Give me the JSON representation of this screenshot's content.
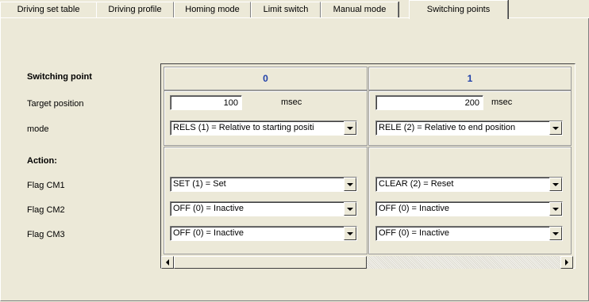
{
  "tabs": [
    {
      "label": "Driving set table",
      "active": false
    },
    {
      "label": "Driving profile",
      "active": false
    },
    {
      "label": "Homing mode",
      "active": false
    },
    {
      "label": "Limit switch",
      "active": false
    },
    {
      "label": "Manual mode",
      "active": false
    },
    {
      "label": "Switching points",
      "active": true
    }
  ],
  "rows": {
    "switching_point": "Switching point",
    "target_position": "Target position",
    "mode": "mode",
    "action": "Action:",
    "flag_cm1": "Flag CM1",
    "flag_cm2": "Flag CM2",
    "flag_cm3": "Flag CM3"
  },
  "columns": [
    {
      "header": "0",
      "target_position": "100",
      "unit": "msec",
      "mode": "RELS (1) = Relative to starting positi",
      "flag_cm1": "SET (1) = Set",
      "flag_cm2": "OFF (0) = Inactive",
      "flag_cm3": "OFF (0) = Inactive"
    },
    {
      "header": "1",
      "target_position": "200",
      "unit": "msec",
      "mode": "RELE (2) = Relative to end position",
      "flag_cm1": "CLEAR (2) = Reset",
      "flag_cm2": "OFF (0) = Inactive",
      "flag_cm3": "OFF (0) = Inactive"
    }
  ],
  "scrollbar": {
    "position": 0.0
  },
  "colors": {
    "header_text": "#1f3fa8",
    "background": "#ece9d8"
  }
}
